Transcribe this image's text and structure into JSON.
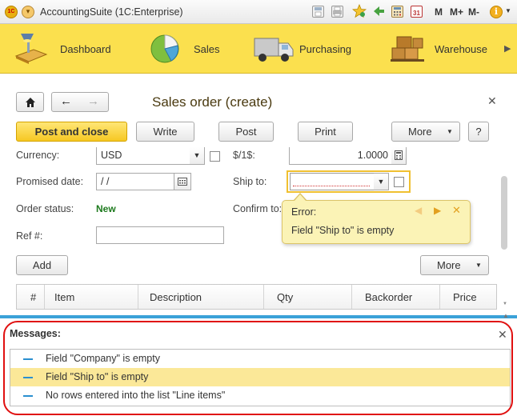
{
  "window": {
    "title": "AccountingSuite (1C:Enterprise)",
    "toolbar": [
      "M",
      "M+",
      "M-"
    ],
    "calendar_day": "31"
  },
  "sections": [
    {
      "label": "Dashboard",
      "icon": "desk-lamp-icon"
    },
    {
      "label": "Sales",
      "icon": "pie-chart-icon"
    },
    {
      "label": "Purchasing",
      "icon": "truck-icon"
    },
    {
      "label": "Warehouse",
      "icon": "boxes-icon"
    }
  ],
  "form": {
    "title": "Sales order (create)",
    "buttons": {
      "post_and_close": "Post and close",
      "write": "Write",
      "post": "Post",
      "print": "Print",
      "more": "More",
      "help": "?",
      "add": "Add",
      "more2": "More"
    },
    "fields": {
      "currency_label": "Currency:",
      "currency_value": "USD",
      "rate_label": "$/1$:",
      "rate_value": "1.0000",
      "promised_label": "Promised date:",
      "promised_value": " /  /",
      "ship_to_label": "Ship to:",
      "ship_to_value": "",
      "status_label": "Order status:",
      "status_value": "New",
      "confirm_label": "Confirm to:",
      "ref_label": "Ref #:",
      "ref_value": ""
    },
    "table_columns": [
      "#",
      "Item",
      "Description",
      "Qty",
      "Backorder",
      "Price"
    ]
  },
  "tooltip": {
    "title": "Error:",
    "message": "Field \"Ship to\" is empty"
  },
  "messages": {
    "title": "Messages:",
    "items": [
      {
        "text": "Field \"Company\" is empty",
        "selected": false
      },
      {
        "text": "Field \"Ship to\" is empty",
        "selected": true
      },
      {
        "text": "No rows entered into the list \"Line items\"",
        "selected": false
      }
    ]
  },
  "colors": {
    "accent_yellow": "#fbe04e",
    "primary_button": "#f6c823",
    "splitter": "#3aa1d8",
    "status_green": "#1d7a1d",
    "highlight_red": "#e01010"
  }
}
